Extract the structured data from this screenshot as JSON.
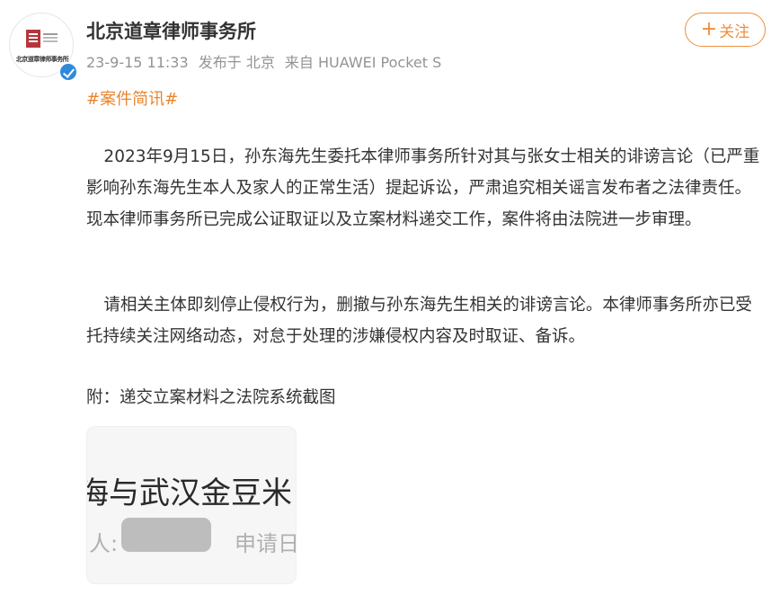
{
  "post": {
    "author": "北京道章律师事务所",
    "avatar_caption": "北京道章律师事务所",
    "timestamp": "23-9-15 11:33",
    "published_at": "发布于 北京",
    "device": "来自 HUAWEI Pocket S",
    "follow_label": "关注",
    "follow_plus": "+",
    "topic": "#案件简讯#",
    "paragraph_1": "2023年9月15日，孙东海先生委托本律师事务所针对其与张女士相关的诽谤言论（已严重影响孙东海先生本人及家人的正常生活）提起诉讼，严肃追究相关谣言发布者之法律责任。现本律师事务所已完成公证取证以及立案材料递交工作，案件将由法院进一步审理。",
    "paragraph_2": "请相关主体即刻停止侵权行为，删撤与孙东海先生相关的诽谤言论。本律师事务所亦已受托持续关注网络动态，对怠于处理的涉嫌侵权内容及时取证、备诉。",
    "attachment_note": "附：递交立案材料之法院系统截图"
  },
  "image_preview": {
    "headline": "海与武汉金豆米",
    "field_label": "人:",
    "field_label_2": "申请日"
  },
  "colors": {
    "accent": "#ef8f3e",
    "topic": "#e8862f",
    "verified": "#2f8bd9",
    "meta_text": "#939393"
  },
  "icons": [
    "verified-badge-icon",
    "plus-icon"
  ]
}
